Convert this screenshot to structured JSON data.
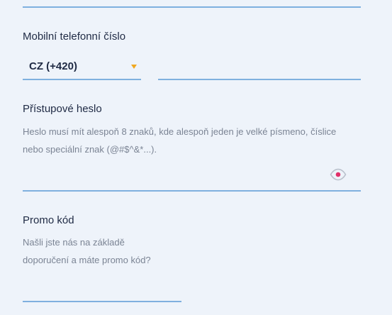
{
  "phone": {
    "label": "Mobilní telefonní číslo",
    "country_select": {
      "value": "CZ (+420)"
    },
    "number_input": {
      "value": "",
      "placeholder": ""
    }
  },
  "password": {
    "label": "Přístupové heslo",
    "hint_line1": "Heslo musí mít alespoň 8 znaků, kde alespoň jeden je velké písmeno, číslice",
    "hint_line2": "nebo speciální znak (@#$^&*...).",
    "input": {
      "value": "",
      "placeholder": ""
    },
    "toggle_icon": "eye-icon"
  },
  "promo": {
    "label": "Promo kód",
    "hint_line1": "Našli jste nás na základě",
    "hint_line2": "doporučení a máte promo kód?",
    "input": {
      "value": "",
      "placeholder": ""
    }
  },
  "colors": {
    "background": "#eef3fa",
    "underline": "#7fb0df",
    "caret": "#f0a81f",
    "eye_pupil": "#e0306a",
    "label_text": "#1f2a44",
    "hint_text": "#7b8494"
  }
}
